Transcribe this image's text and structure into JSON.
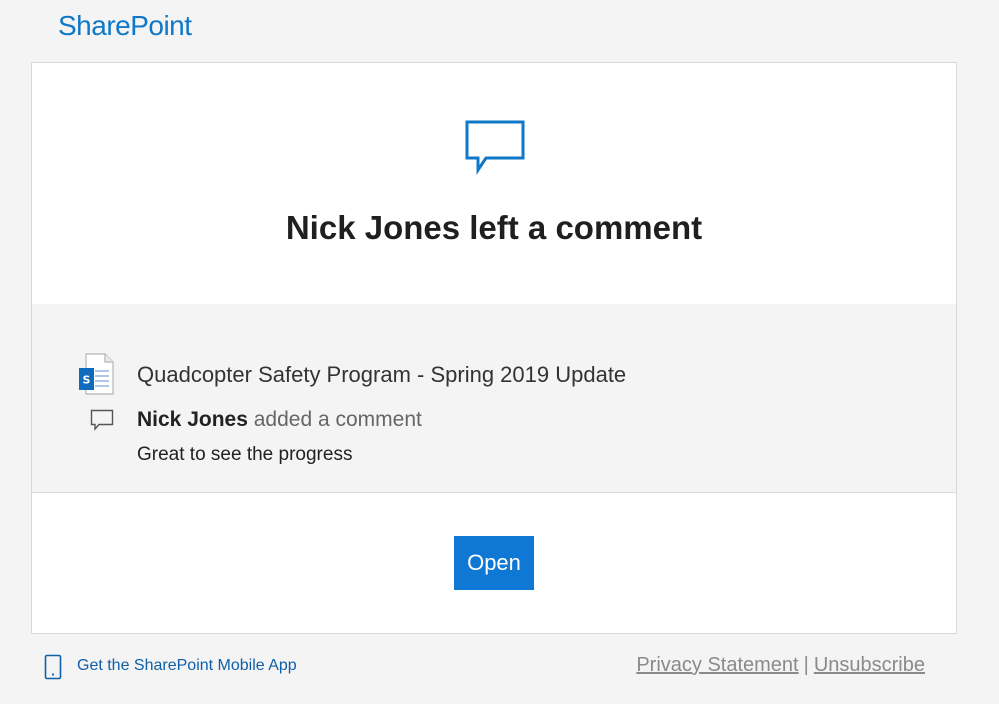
{
  "header": {
    "brand": "SharePoint"
  },
  "hero": {
    "icon": "comment-bubble-icon",
    "title": "Nick Jones left a comment"
  },
  "details": {
    "doc_icon": "sharepoint-page-icon",
    "document_title": "Quadcopter Safety Program - Spring 2019 Update",
    "comment_icon": "comment-icon",
    "author": "Nick Jones",
    "action_text": " added a comment",
    "comment_text": "Great to see the progress"
  },
  "actions": {
    "open_label": "Open"
  },
  "footer": {
    "mobile_icon": "phone-icon",
    "mobile_app_link": "Get the SharePoint Mobile App",
    "privacy_link": "Privacy Statement",
    "separator": "|",
    "unsubscribe_link": "Unsubscribe"
  },
  "colors": {
    "brand": "#0f78c8",
    "button": "#0f78d4",
    "background": "#f4f4f4"
  }
}
